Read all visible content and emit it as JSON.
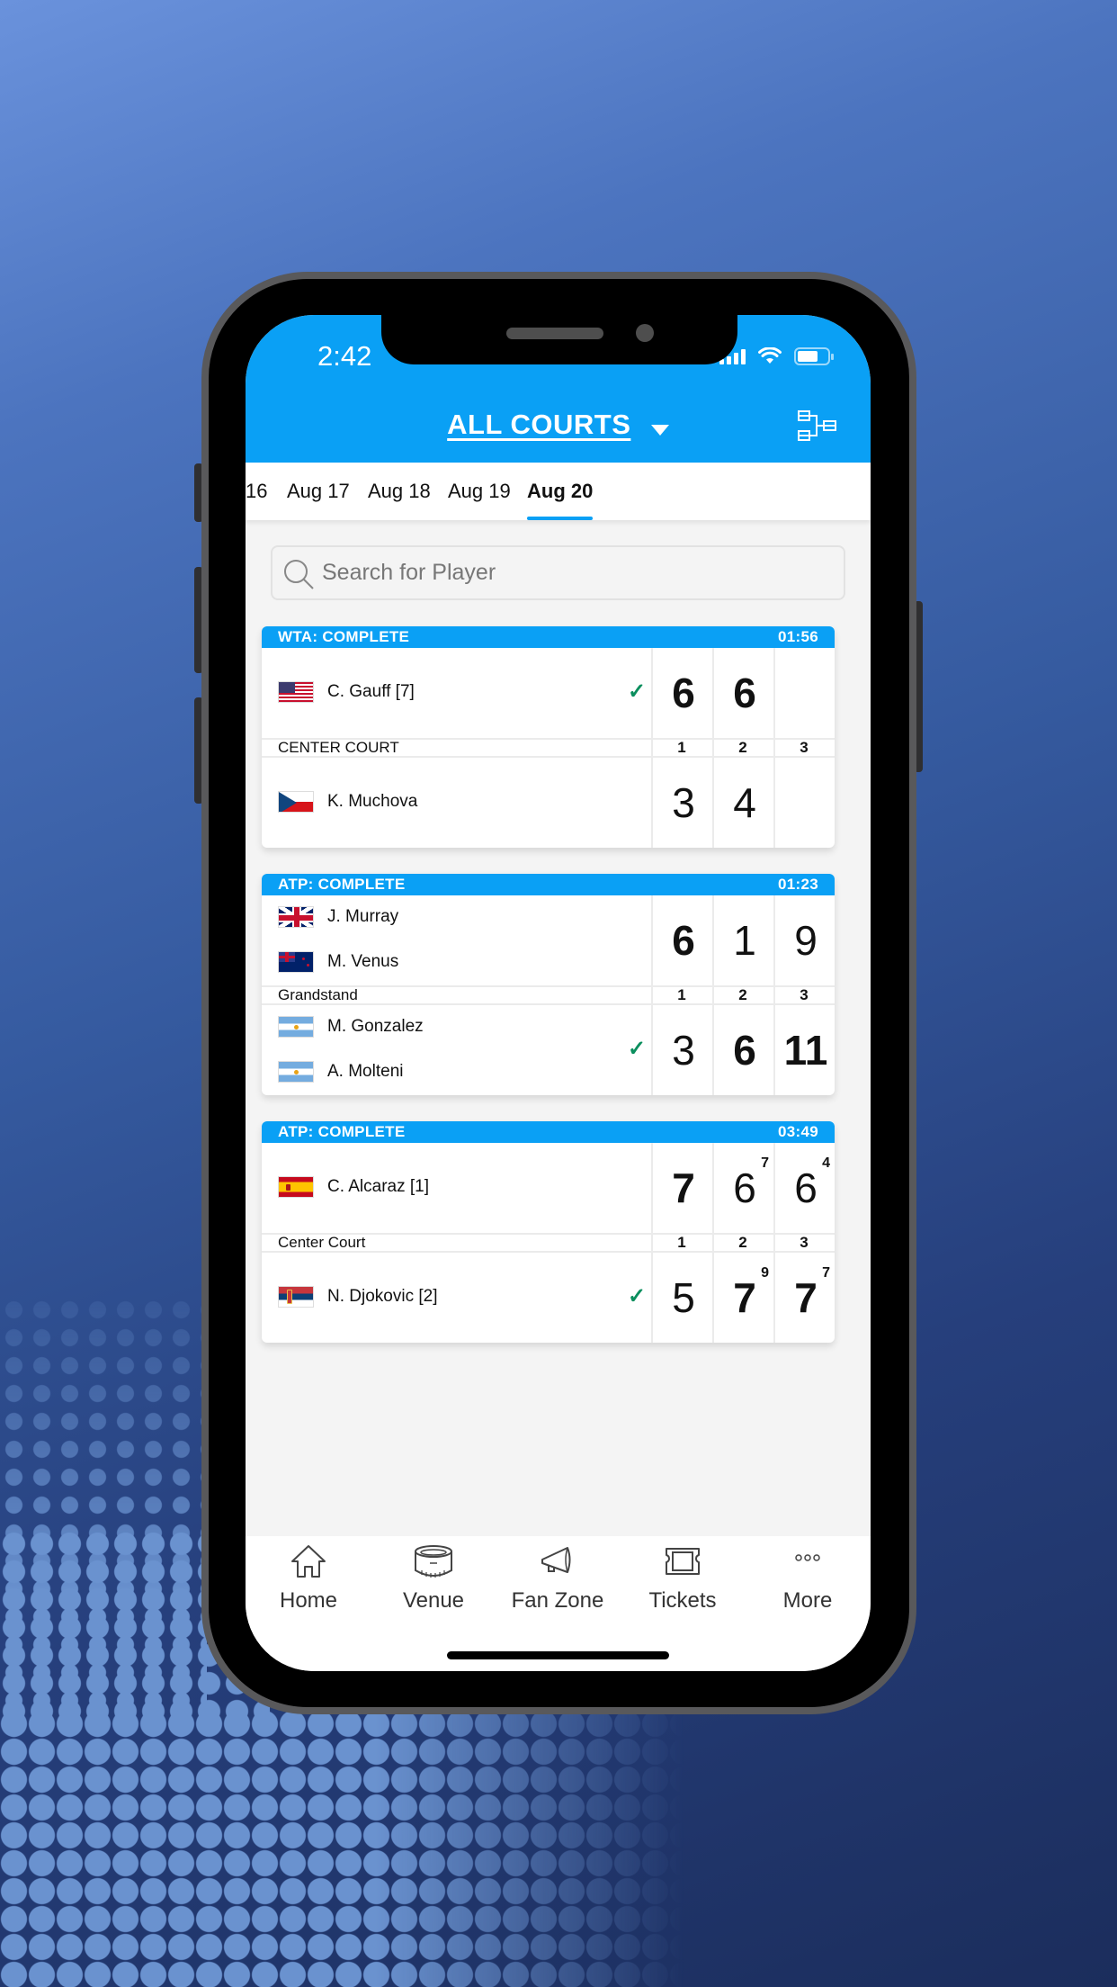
{
  "status_bar": {
    "time": "2:42"
  },
  "header": {
    "title": "ALL COURTS",
    "bracket_icon": "bracket-icon"
  },
  "date_tabs": [
    {
      "label": "16",
      "active": false
    },
    {
      "label": "Aug 17",
      "active": false
    },
    {
      "label": "Aug 18",
      "active": false
    },
    {
      "label": "Aug 19",
      "active": false
    },
    {
      "label": "Aug 20",
      "active": true
    }
  ],
  "search": {
    "placeholder": "Search for Player",
    "value": ""
  },
  "set_labels": [
    "1",
    "2",
    "3"
  ],
  "matches": [
    {
      "status": "WTA: COMPLETE",
      "duration": "01:56",
      "court": "CENTER COURT",
      "top": {
        "players": [
          {
            "name": "C. Gauff [7]",
            "flag": "USA"
          }
        ],
        "winner": true,
        "scores": [
          "6",
          "6",
          ""
        ],
        "tiebreaks": [
          "",
          "",
          ""
        ],
        "bold": [
          true,
          true,
          false
        ]
      },
      "bottom": {
        "players": [
          {
            "name": "K. Muchova",
            "flag": "CZE"
          }
        ],
        "winner": false,
        "scores": [
          "3",
          "4",
          ""
        ],
        "tiebreaks": [
          "",
          "",
          ""
        ],
        "bold": [
          false,
          false,
          false
        ]
      }
    },
    {
      "status": "ATP: COMPLETE",
      "duration": "01:23",
      "court": "Grandstand",
      "top": {
        "players": [
          {
            "name": "J. Murray",
            "flag": "GBR"
          },
          {
            "name": "M. Venus",
            "flag": "NZL"
          }
        ],
        "winner": false,
        "scores": [
          "6",
          "1",
          "9"
        ],
        "tiebreaks": [
          "",
          "",
          ""
        ],
        "bold": [
          true,
          false,
          false
        ]
      },
      "bottom": {
        "players": [
          {
            "name": "M. Gonzalez",
            "flag": "ARG"
          },
          {
            "name": "A. Molteni",
            "flag": "ARG"
          }
        ],
        "winner": true,
        "scores": [
          "3",
          "6",
          "11"
        ],
        "tiebreaks": [
          "",
          "",
          ""
        ],
        "bold": [
          false,
          true,
          true
        ]
      }
    },
    {
      "status": "ATP: COMPLETE",
      "duration": "03:49",
      "court": "Center Court",
      "top": {
        "players": [
          {
            "name": "C. Alcaraz [1]",
            "flag": "ESP"
          }
        ],
        "winner": false,
        "scores": [
          "7",
          "6",
          "6"
        ],
        "tiebreaks": [
          "",
          "7",
          "4"
        ],
        "bold": [
          true,
          false,
          false
        ]
      },
      "bottom": {
        "players": [
          {
            "name": "N. Djokovic [2]",
            "flag": "SRB"
          }
        ],
        "winner": true,
        "scores": [
          "5",
          "7",
          "7"
        ],
        "tiebreaks": [
          "",
          "9",
          "7"
        ],
        "bold": [
          false,
          true,
          true
        ]
      }
    }
  ],
  "bottom_nav": [
    {
      "label": "Home",
      "icon": "home-icon"
    },
    {
      "label": "Venue",
      "icon": "stadium-icon"
    },
    {
      "label": "Fan Zone",
      "icon": "megaphone-icon"
    },
    {
      "label": "Tickets",
      "icon": "ticket-icon"
    },
    {
      "label": "More",
      "icon": "more-icon"
    }
  ],
  "colors": {
    "accent": "#0aa0f5",
    "winner_check": "#0b8f5e",
    "background_top": "#6a92dc",
    "background_bottom": "#1b2d5c"
  }
}
